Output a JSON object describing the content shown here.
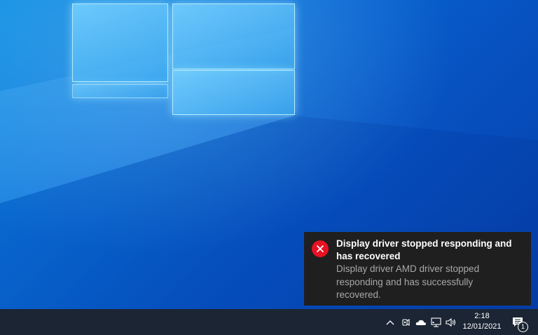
{
  "toast": {
    "icon": "error-icon",
    "title": "Display driver stopped responding and has recovered",
    "body": "Display driver AMD driver stopped responding and has successfully recovered."
  },
  "taskbar": {
    "tray_icons": [
      "chevron-up-icon",
      "meet-now-icon",
      "onedrive-cloud-icon",
      "network-icon",
      "volume-icon"
    ],
    "clock": {
      "time": "2:18",
      "date": "12/01/2021"
    },
    "notifications": {
      "icon": "action-center-icon",
      "count": "1"
    }
  },
  "colors": {
    "desktop_blue": "#0a6fd8",
    "taskbar": "#1c2533",
    "toast_bg": "#1f1f1f",
    "error_red": "#e81123"
  }
}
